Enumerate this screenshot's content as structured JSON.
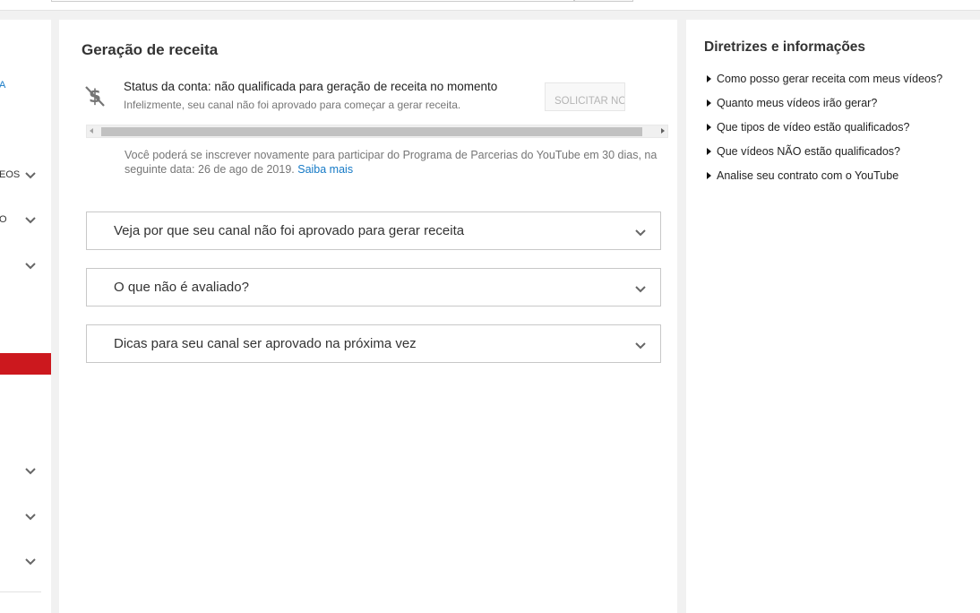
{
  "sidebar": {
    "items": [
      {
        "label": "A",
        "is_link": true,
        "chevron": false
      },
      {
        "label": "EOS",
        "is_link": false,
        "chevron": true
      },
      {
        "label": "O",
        "is_link": false,
        "chevron": true
      },
      {
        "label": "",
        "is_link": false,
        "chevron": true
      },
      {
        "label": "",
        "is_link": false,
        "chevron": true
      },
      {
        "label": "",
        "is_link": false,
        "chevron": true
      },
      {
        "label": "",
        "is_link": false,
        "chevron": true
      }
    ],
    "active_color": "#cc181e"
  },
  "main": {
    "title": "Geração de receita",
    "status": {
      "icon": "no-dollar-icon",
      "title": "Status da conta: não qualificada para geração de receita no momento",
      "subtitle": "Infelizmente, seu canal não foi aprovado para começar a gerar receita.",
      "button_label": "SOLICITAR NOVAMENTE"
    },
    "reapply": {
      "text": "Você poderá se inscrever novamente para participar do Programa de Parcerias do YouTube em 30 dias, na seguinte data: 26 de ago de 2019.",
      "link": "Saiba mais"
    },
    "accordions": [
      {
        "label": "Veja por que seu canal não foi aprovado para gerar receita"
      },
      {
        "label": "O que não é avaliado?"
      },
      {
        "label": "Dicas para seu canal ser aprovado na próxima vez"
      }
    ]
  },
  "right": {
    "title": "Diretrizes e informações",
    "links": [
      "Como posso gerar receita com meus vídeos?",
      "Quanto meus vídeos irão gerar?",
      "Que tipos de vídeo estão qualificados?",
      "Que vídeos NÃO estão qualificados?",
      "Analise seu contrato com o YouTube"
    ]
  },
  "colors": {
    "link": "#167ac6",
    "accent": "#cc181e"
  }
}
